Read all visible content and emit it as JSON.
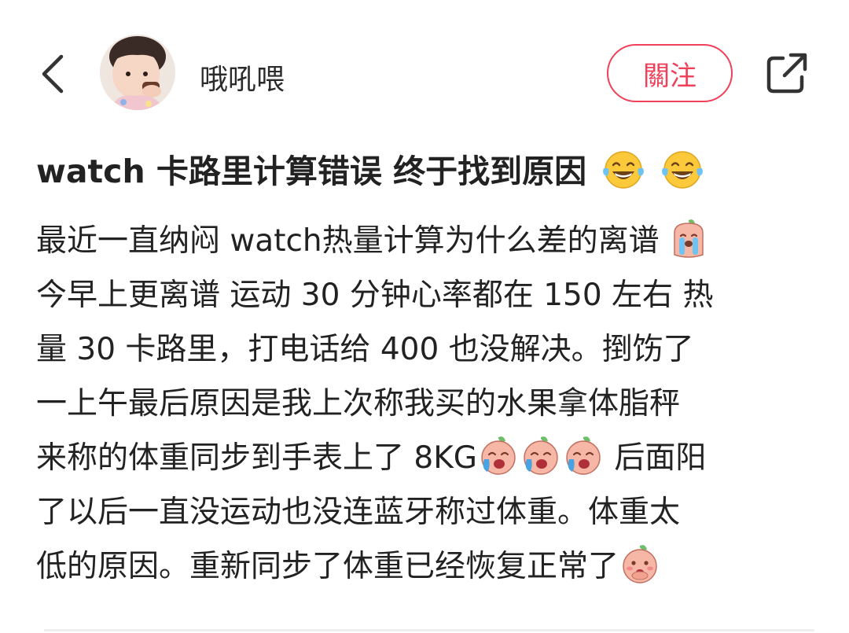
{
  "header": {
    "username": "哦吼喂",
    "follow_label": "關注"
  },
  "post": {
    "title": "watch 卡路里计算错误 终于找到原因",
    "lines": [
      "最近一直纳闷 watch热量计算为什么差的离谱",
      "今早上更离谱 运动 30 分钟心率都在 150 左右 热",
      "量 30 卡路里，打电话给 400 也没解决。捯饬了",
      "一上午最后原因是我上次称我买的水果拿体脂秤",
      "来称的体重同步到手表上了 8KG",
      "后面阳",
      "了以后一直没运动也没连蓝牙称过体重。体重太",
      "低的原因。重新同步了体重已经恢复正常了"
    ]
  },
  "icons": {
    "back": "back-arrow-icon",
    "share": "share-icon",
    "laugh": "tears-of-joy-emoji",
    "crying": "crying-peach-emoji",
    "shy": "shy-peach-emoji"
  },
  "colors": {
    "accent": "#f0405a",
    "text": "#222222"
  }
}
